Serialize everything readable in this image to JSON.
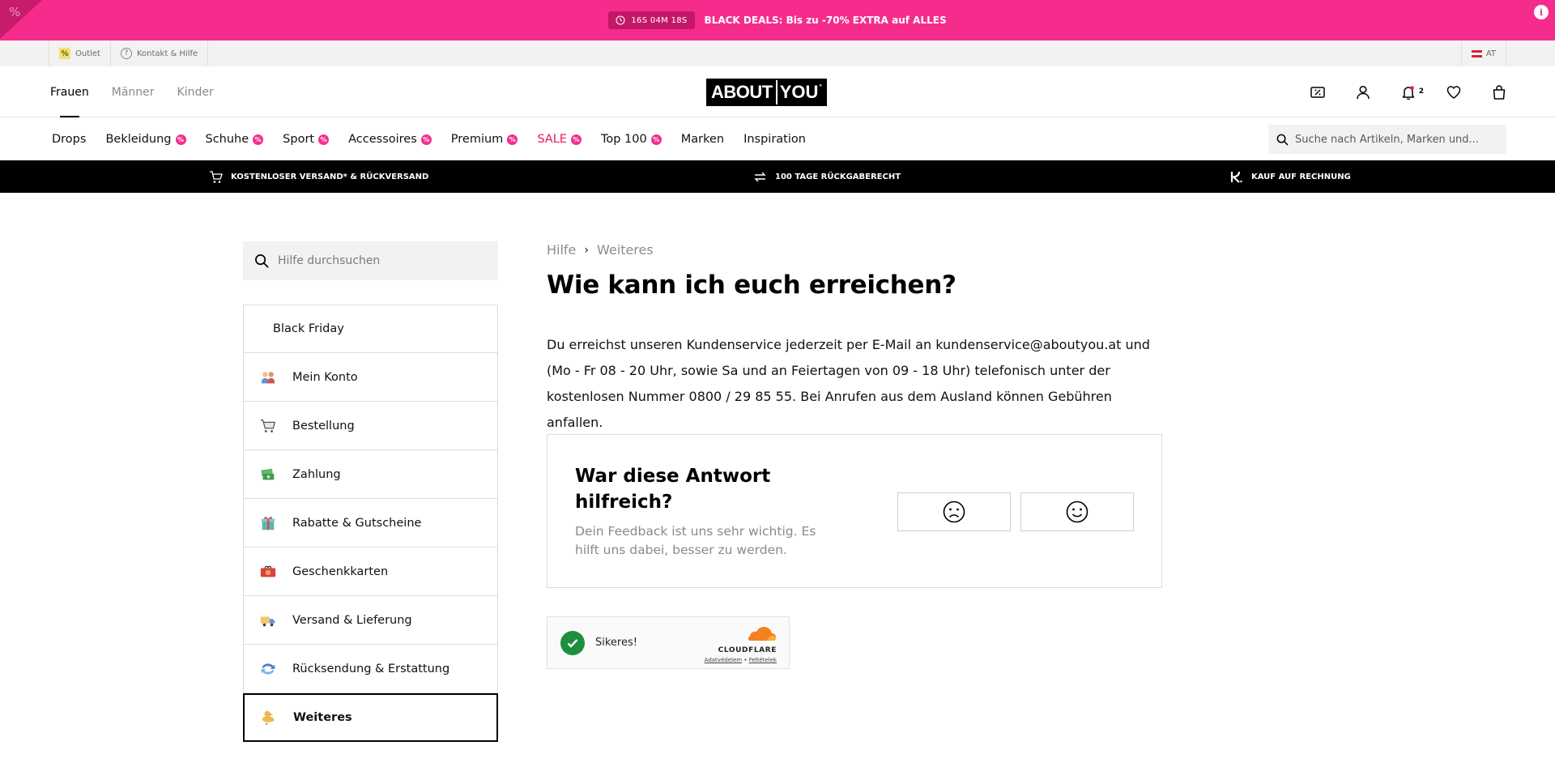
{
  "promo": {
    "timer": "16S 04M 18S",
    "text": "BLACK DEALS: Bis zu -70% EXTRA auf ALLES",
    "corner_glyph": "%",
    "info_glyph": "i",
    "accent": "#f52c8c"
  },
  "utility": {
    "outlet": "Outlet",
    "help": "Kontakt & Hilfe",
    "country": "AT"
  },
  "header": {
    "gender_tabs": [
      "Frauen",
      "Männer",
      "Kinder"
    ],
    "logo_left": "ABOUT",
    "logo_right": "YOU",
    "logo_mark": "°",
    "notifications_count": "2",
    "icons": [
      "discount-icon",
      "user-icon",
      "bell-icon",
      "heart-icon",
      "bag-icon"
    ]
  },
  "nav": {
    "items": [
      "Drops",
      "Bekleidung",
      "Schuhe",
      "Sport",
      "Accessoires",
      "Premium",
      "SALE",
      "Top 100",
      "Marken",
      "Inspiration"
    ],
    "badge_glyph": "%",
    "search_placeholder": "Suche nach Artikeln, Marken und..."
  },
  "usp": {
    "shipping": "KOSTENLOSER VERSAND* & RÜCKVERSAND",
    "returns": "100 TAGE RÜCKGABERECHT",
    "invoice": "KAUF AUF RECHNUNG"
  },
  "sidebar": {
    "search_placeholder": "Hilfe durchsuchen",
    "items": [
      {
        "label": "Black Friday",
        "icon": ""
      },
      {
        "label": "Mein Konto",
        "icon": "people-icon"
      },
      {
        "label": "Bestellung",
        "icon": "cart-icon"
      },
      {
        "label": "Zahlung",
        "icon": "money-icon"
      },
      {
        "label": "Rabatte & Gutscheine",
        "icon": "gift-icon"
      },
      {
        "label": "Geschenkkarten",
        "icon": "giftcard-icon"
      },
      {
        "label": "Versand & Lieferung",
        "icon": "truck-icon"
      },
      {
        "label": "Rücksendung & Erstattung",
        "icon": "return-icon"
      },
      {
        "label": "Weiteres",
        "icon": "duck-icon"
      }
    ]
  },
  "content": {
    "breadcrumb": [
      "Hilfe",
      "Weiteres"
    ],
    "breadcrumb_separator": "›",
    "title": "Wie kann ich euch erreichen?",
    "answer": "Du erreichst unseren Kundenservice jederzeit per E-Mail an kundenservice@aboutyou.at und (Mo - Fr 08 - 20 Uhr, sowie Sa und an Feiertagen von 09 - 18 Uhr) telefonisch unter der kostenlosen Nummer 0800 / 29 85 55. Bei Anrufen aus dem Ausland können Gebühren anfallen.",
    "feedback": {
      "title": "War diese Antwort hilfreich?",
      "subtitle": "Dein Feedback ist uns sehr wichtig. Es hilft uns dabei, besser zu werden."
    }
  },
  "cloudflare": {
    "status": "Sikeres!",
    "brand": "CLOUDFLARE",
    "link_privacy": "Adatvédelem",
    "link_separator": "•",
    "link_terms": "Feltételek"
  }
}
